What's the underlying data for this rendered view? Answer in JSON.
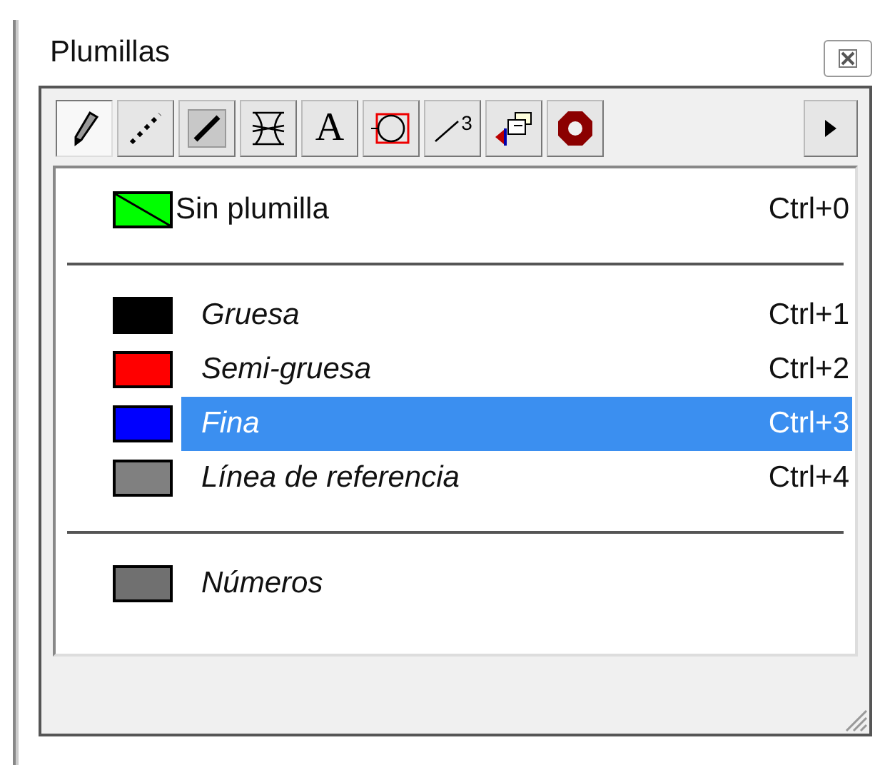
{
  "panel": {
    "title": "Plumillas"
  },
  "toolbar": {
    "tools": [
      {
        "selected": true
      },
      {
        "selected": false
      },
      {
        "selected": false
      },
      {
        "selected": false
      },
      {
        "selected": false,
        "label": "A"
      },
      {
        "selected": false
      },
      {
        "selected": false,
        "label": "3"
      },
      {
        "selected": false
      },
      {
        "selected": false
      }
    ]
  },
  "pen_groups": [
    {
      "items": [
        {
          "kind": "none",
          "label": "Sin plumilla",
          "shortcut": "Ctrl+0",
          "color": "#00ff00",
          "selected": false
        }
      ]
    },
    {
      "items": [
        {
          "kind": "pen",
          "label": "Gruesa",
          "shortcut": "Ctrl+1",
          "color": "#000000",
          "selected": false
        },
        {
          "kind": "pen",
          "label": "Semi-gruesa",
          "shortcut": "Ctrl+2",
          "color": "#ff0000",
          "selected": false
        },
        {
          "kind": "pen",
          "label": "Fina",
          "shortcut": "Ctrl+3",
          "color": "#0000ff",
          "selected": true
        },
        {
          "kind": "pen",
          "label": "Línea de referencia",
          "shortcut": "Ctrl+4",
          "color": "#808080",
          "selected": false
        }
      ]
    },
    {
      "items": [
        {
          "kind": "pen",
          "label": "Números",
          "color": "#707070",
          "selected": false
        }
      ]
    }
  ]
}
